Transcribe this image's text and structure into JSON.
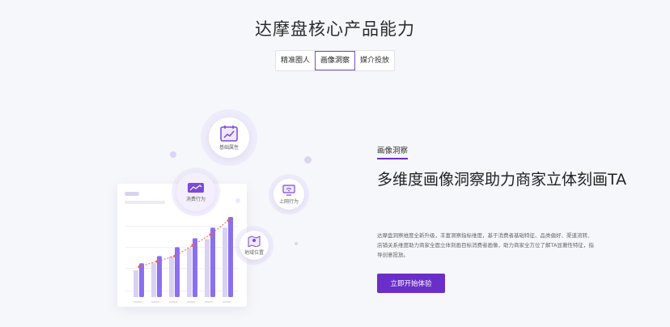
{
  "section": {
    "title": "达摩盘核心产品能力"
  },
  "tabs": [
    {
      "label": "精准圈人",
      "active": false
    },
    {
      "label": "画像洞察",
      "active": true
    },
    {
      "label": "媒介投放",
      "active": false
    }
  ],
  "illustration": {
    "bubbles": [
      {
        "label": "基础属性",
        "icon": "calendar-chart-icon"
      },
      {
        "label": "消费行为",
        "icon": "wallet-chart-icon"
      },
      {
        "label": "上网行为",
        "icon": "monitor-wifi-icon"
      },
      {
        "label": "地域位置",
        "icon": "map-pin-icon"
      }
    ],
    "chart_bars": [
      [
        0.3,
        0.38
      ],
      [
        0.38,
        0.46
      ],
      [
        0.46,
        0.56
      ],
      [
        0.55,
        0.66
      ],
      [
        0.65,
        0.78
      ],
      [
        0.78,
        0.9
      ]
    ],
    "chart_trend": [
      0.34,
      0.4,
      0.46,
      0.58,
      0.7,
      0.86
    ],
    "colors": {
      "bar_light": "#d9d2f2",
      "bar_dark": "#8a6ff0",
      "trend": "#f0604a"
    }
  },
  "content": {
    "tag": "画像洞察",
    "headline": "多维度画像洞察助力商家立体刻画TA",
    "description": "达摩盘洞察维度全新升级，丰富洞察指标维度，基于消费者基础特征、品类偏好、渠道流转、店铺关系维度助力商家全面立体刻画目标消费者画像，助力商家全方位了解TA显著性特征，指导创意投放。",
    "cta_label": "立即开始体验"
  }
}
